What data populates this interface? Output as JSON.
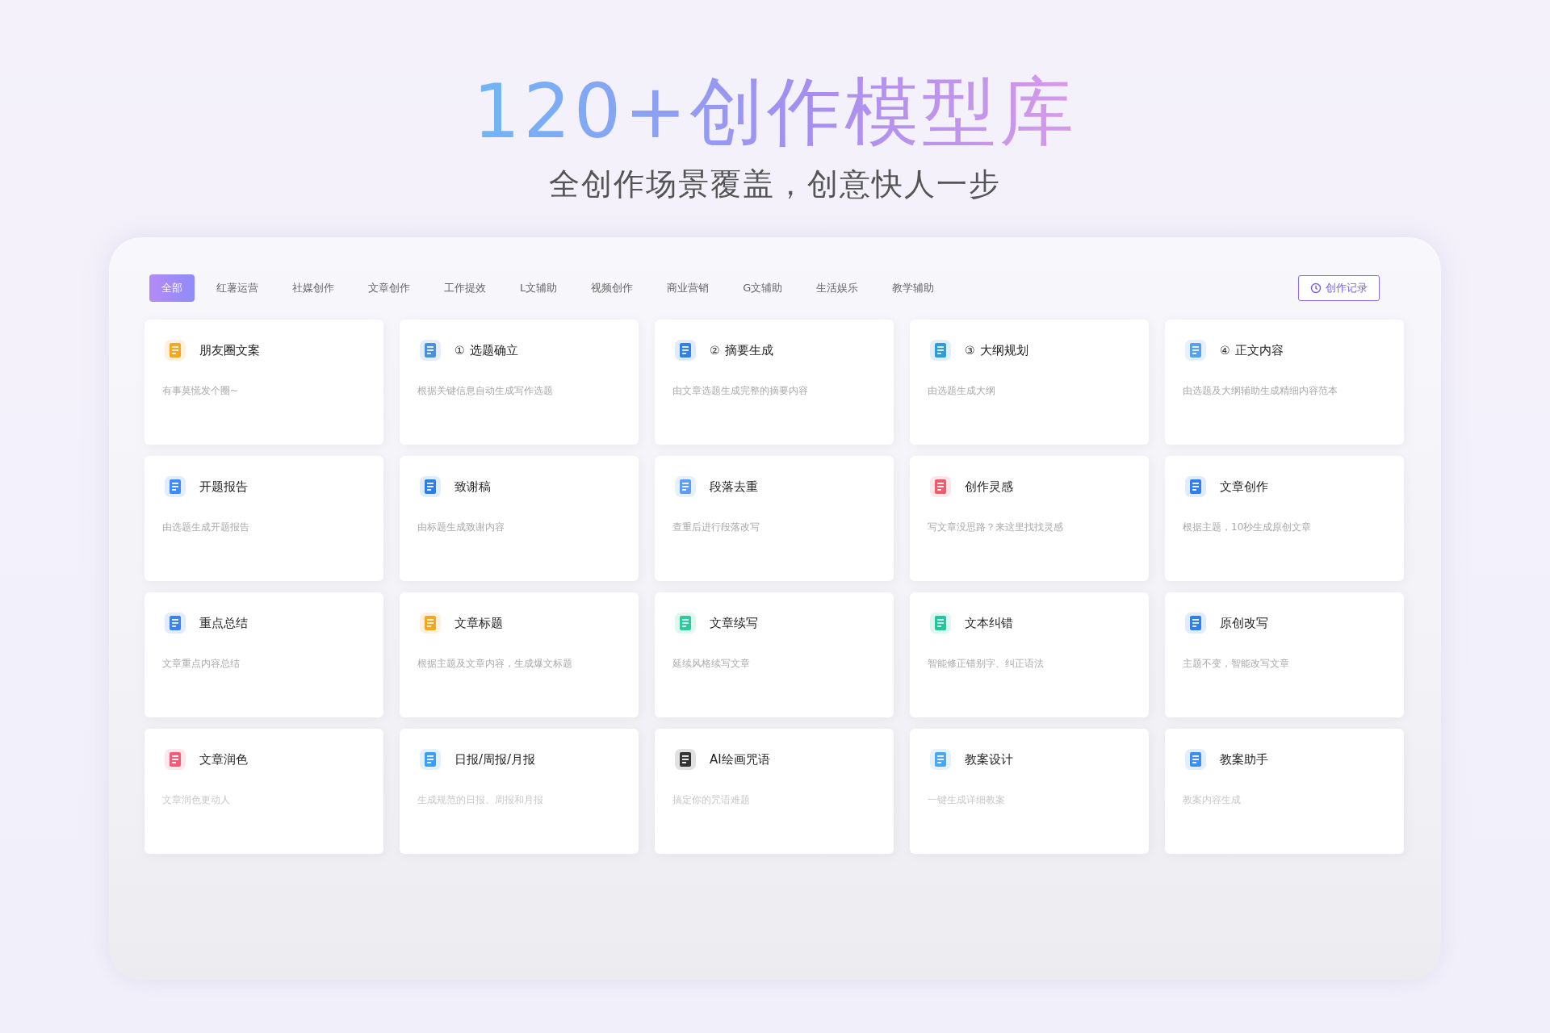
{
  "hero": {
    "title": "120+创作模型库",
    "subtitle": "全创作场景覆盖，创意快人一步"
  },
  "tabs": [
    {
      "label": "全部",
      "selected": true
    },
    {
      "label": "红薯运营",
      "selected": false
    },
    {
      "label": "社媒创作",
      "selected": false
    },
    {
      "label": "文章创作",
      "selected": false
    },
    {
      "label": "工作提效",
      "selected": false
    },
    {
      "label": "L文辅助",
      "selected": false
    },
    {
      "label": "视频创作",
      "selected": false
    },
    {
      "label": "商业营销",
      "selected": false
    },
    {
      "label": "G文辅助",
      "selected": false
    },
    {
      "label": "生活娱乐",
      "selected": false
    },
    {
      "label": "教学辅助",
      "selected": false
    }
  ],
  "history_button": {
    "label": "创作记录"
  },
  "cards": [
    {
      "title": "朋友圈文案",
      "description": "有事莫慌发个圈~",
      "color": "#f5a623"
    },
    {
      "step": "①",
      "title": "选题确立",
      "description": "根据关键信息自动生成写作选题",
      "color": "#4a90e2"
    },
    {
      "step": "②",
      "title": "摘要生成",
      "description": "由文章选题生成完整的摘要内容",
      "color": "#2f80ed"
    },
    {
      "step": "③",
      "title": "大纲规划",
      "description": "由选题生成大纲",
      "color": "#2d9cdb"
    },
    {
      "step": "④",
      "title": "正文内容",
      "description": "由选题及大纲辅助生成精细内容范本",
      "color": "#56a0f0"
    },
    {
      "title": "开题报告",
      "description": "由选题生成开题报告",
      "color": "#3d8bfd"
    },
    {
      "title": "致谢稿",
      "description": "由标题生成致谢内容",
      "color": "#2b7de9"
    },
    {
      "title": "段落去重",
      "description": "查重后进行段落改写",
      "color": "#5b9df9"
    },
    {
      "title": "创作灵感",
      "description": "写文章没思路？来这里找找灵感",
      "color": "#f05a6a"
    },
    {
      "title": "文章创作",
      "description": "根据主题，10秒生成原创文章",
      "color": "#2f80ed"
    },
    {
      "title": "重点总结",
      "description": "文章重点内容总结",
      "color": "#3b82f6"
    },
    {
      "title": "文章标题",
      "description": "根据主题及文章内容，生成爆文标题",
      "color": "#f5a623"
    },
    {
      "title": "文章续写",
      "description": "延续风格续写文章",
      "color": "#2ecc9a"
    },
    {
      "title": "文本纠错",
      "description": "智能修正错别字、纠正语法",
      "color": "#20c997"
    },
    {
      "title": "原创改写",
      "description": "主题不变，智能改写文章",
      "color": "#2f80ed"
    },
    {
      "title": "文章润色",
      "description": "文章润色更动人",
      "color": "#f25c7a"
    },
    {
      "title": "日报/周报/月报",
      "description": "生成规范的日报、周报和月报",
      "color": "#3ba0f5"
    },
    {
      "title": "AI绘画咒语",
      "description": "搞定你的咒语难题",
      "color": "#333333"
    },
    {
      "title": "教案设计",
      "description": "一键生成详细教案",
      "color": "#4aa8f0"
    },
    {
      "title": "教案助手",
      "description": "教案内容生成",
      "color": "#3b8ff0"
    }
  ]
}
